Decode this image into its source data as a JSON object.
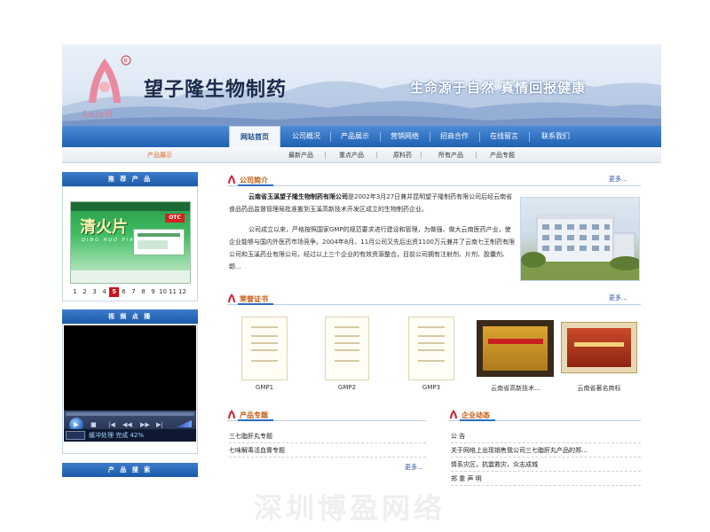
{
  "header": {
    "logo_text": "AnisH",
    "brand_name": "望子隆生物制药",
    "slogan": "生命源于自然  真情回报健康"
  },
  "nav": {
    "items": [
      "网站首页",
      "公司概况",
      "产品展示",
      "营销网络",
      "招商合作",
      "在线留言",
      "联系我们"
    ],
    "active_index": 0
  },
  "subnav": {
    "breadcrumb": "产品展示",
    "items": [
      "最新产品",
      "重点产品",
      "原料药",
      "所有产品",
      "产品专题"
    ]
  },
  "sidebar": {
    "recommend_title": "推 荐 产 品",
    "product": {
      "name": "清火片",
      "pinyin": "QING HUO PIAN",
      "badge": "OTC"
    },
    "pages": [
      "1",
      "2",
      "3",
      "4",
      "5",
      "6",
      "7",
      "8",
      "9",
      "10",
      "11",
      "12"
    ],
    "active_page": "5",
    "video_title": "视 频 点 播",
    "video_status": "缓冲处理  完成 42%",
    "search_title": "产 品 搜 索"
  },
  "intro": {
    "title": "公司简介",
    "more": "更多...",
    "company": "云南省玉溪望子隆生物制药有限公司",
    "para1": "是2002年3月27日兼并昆明望子隆制药有限公司后经云南省食品药品监督管理局批准搬到玉溪高新技术开发区成立的生物制药企业。",
    "para2": "公司成立以来，严格按照国家GMP的规范要求进行建设和管理，为做强、做大云南医药产业，使企业能够与国内外医药市场竞争。2004年8月、11月公司又先后出资1100万元兼并了云南七王制药有限公司和玉溪药业有限公司，经过以上三个企业的有效资源整合，目前公司拥有注射剂、片剂、胶囊剂、颗..."
  },
  "honors": {
    "title": "荣誉证书",
    "more": "更多...",
    "items": [
      "GMP1",
      "GMP2",
      "GMP3",
      "云南省高新技术...",
      "云南省著名商标"
    ]
  },
  "topics": {
    "title": "产品专题",
    "more": "更多...",
    "items": [
      "三七脂肝丸专题",
      "七味解毒活血膏专题"
    ]
  },
  "news": {
    "title": "企业动态",
    "items": [
      "公  告",
      "关于网络上出现销售我公司三七脂肝丸产品的郑...",
      "情系灾区，抗震救灾，众志成城",
      "郑 重 声 明"
    ]
  },
  "footer": {
    "watermark": "深圳博盈网络"
  },
  "colors": {
    "nav_blue": "#1f61b3",
    "accent_orange": "#c25a12",
    "link_blue": "#2a55a8",
    "active_page_red": "#c8161e"
  }
}
